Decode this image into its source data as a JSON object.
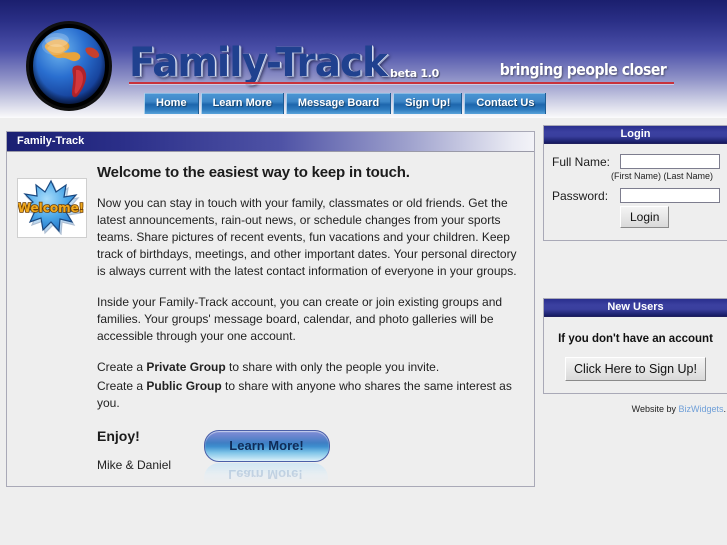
{
  "header": {
    "logo_text": "Family-Track",
    "beta_label": "beta 1.0",
    "tagline": "bringing people closer",
    "globe_icon": "globe-icon",
    "nav": [
      {
        "label": "Home"
      },
      {
        "label": "Learn More"
      },
      {
        "label": "Message Board"
      },
      {
        "label": "Sign Up!"
      },
      {
        "label": "Contact Us"
      }
    ]
  },
  "main": {
    "panel_title": "Family-Track",
    "welcome_badge": "Welcome!",
    "headline": "Welcome to the easiest way to keep in touch.",
    "paragraph1": "Now you can stay in touch with your family, classmates or old friends. Get the latest announcements, rain-out news, or schedule changes from your sports teams. Share pictures of recent events, fun vacations and your children. Keep track of birthdays, meetings, and other important dates. Your personal directory is always current with the latest contact information of everyone in your groups.",
    "paragraph2": "Inside your Family-Track account, you can create or join existing groups and families. Your groups' message board, calendar, and photo galleries will be accessible through your one account.",
    "private_line_pre": "Create a ",
    "private_line_bold": "Private Group",
    "private_line_post": " to share with only the people you invite.",
    "public_line_pre": "Create a ",
    "public_line_bold": "Public Group",
    "public_line_post": " to share with anyone who shares the same interest as you.",
    "enjoy": "Enjoy!",
    "signoff": "Mike & Daniel",
    "learn_more_button": "Learn More!"
  },
  "login": {
    "title": "Login",
    "fullname_label": "Full Name:",
    "fullname_value": "",
    "fullname_placeholder": "",
    "fullname_hint": "(First Name) (Last Name)",
    "password_label": "Password:",
    "password_value": "",
    "password_placeholder": "",
    "submit_label": "Login"
  },
  "new_users": {
    "title": "New Users",
    "message": "If you don't have an account",
    "signup_button": "Click Here to Sign Up!"
  },
  "credit": {
    "prefix": "Website by ",
    "link": "BizWidgets",
    "suffix": "."
  },
  "colors": {
    "header_top": "#1b1f6e",
    "panel_title_start": "#1a1f72",
    "nav_blue": "#3e87c8",
    "rule_red": "#c8323c",
    "page_bg": "#eeeeee",
    "link_blue": "#6f9fd8"
  }
}
